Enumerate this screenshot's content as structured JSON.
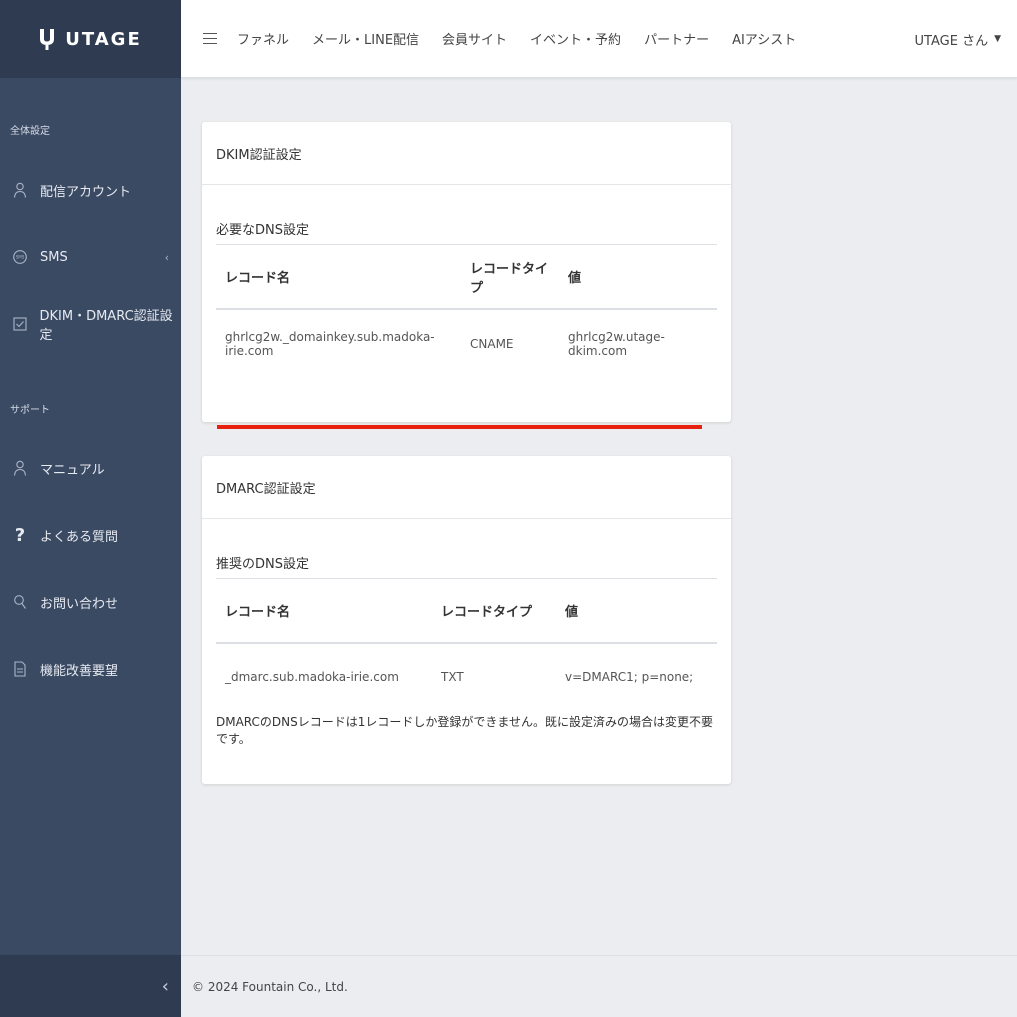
{
  "brand": {
    "name": "UTAGE"
  },
  "sidebar": {
    "section_global": "全体設定",
    "section_support": "サポート",
    "items": [
      {
        "label": "配信アカウント",
        "icon": "person-icon"
      },
      {
        "label": "SMS",
        "icon": "sms-icon"
      },
      {
        "label": "DKIM・DMARC認証設定",
        "icon": "checkbox-icon"
      },
      {
        "label": "マニュアル",
        "icon": "person-icon"
      },
      {
        "label": "よくある質問",
        "icon": "question-icon"
      },
      {
        "label": "お問い合わせ",
        "icon": "search-icon"
      },
      {
        "label": "機能改善要望",
        "icon": "document-icon"
      }
    ],
    "collapse_glyph": "‹"
  },
  "topbar": {
    "nav": [
      "ファネル",
      "メール・LINE配信",
      "会員サイト",
      "イベント・予約",
      "パートナー",
      "AIアシスト"
    ],
    "user": "UTAGE さん"
  },
  "dkim": {
    "title": "DKIM認証設定",
    "section": "必要なDNS設定",
    "headers": [
      "レコード名",
      "レコードタイプ",
      "値"
    ],
    "rows": [
      [
        "ghrlcg2w._domainkey.sub.madoka-irie.com",
        "CNAME",
        "ghrlcg2w.utage-dkim.com"
      ]
    ]
  },
  "dmarc": {
    "title": "DMARC認証設定",
    "section": "推奨のDNS設定",
    "headers": [
      "レコード名",
      "レコードタイプ",
      "値"
    ],
    "rows": [
      [
        "_dmarc.sub.madoka-irie.com",
        "TXT",
        "v=DMARC1; p=none;"
      ]
    ],
    "note": "DMARCのDNSレコードは1レコードしか登録ができません。既に設定済みの場合は変更不要です。"
  },
  "footer": {
    "copyright": "© 2024 Fountain Co., Ltd."
  },
  "colors": {
    "sidebar_bg": "#3b4a63",
    "sidebar_header_bg": "#2f3b50",
    "highlight_red": "#e8200f",
    "page_bg": "#ecedf0"
  }
}
